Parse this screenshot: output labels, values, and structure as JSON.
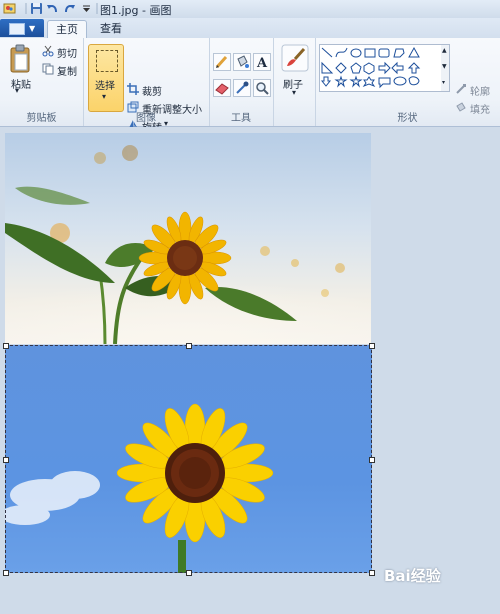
{
  "titlebar": {
    "title": "图1.jpg - 画图"
  },
  "tabs": {
    "home": "主页",
    "view": "查看"
  },
  "clipboard": {
    "paste": "粘贴",
    "cut": "剪切",
    "copy": "复制",
    "label": "剪贴板"
  },
  "image": {
    "select": "选择",
    "crop": "裁剪",
    "resize": "重新调整大小",
    "rotate": "旋转",
    "label": "图像"
  },
  "tools": {
    "label": "工具"
  },
  "brushes": {
    "label": "刷子"
  },
  "shapes": {
    "outline": "轮廓",
    "fill": "填充",
    "label": "形状"
  },
  "watermark": {
    "text": "Bai经验"
  },
  "colors": {
    "accent": "#fbd36a",
    "file_button": "#1d4f9b",
    "sky_blue": "#5c94e2",
    "sunflower": "#f5c400"
  }
}
